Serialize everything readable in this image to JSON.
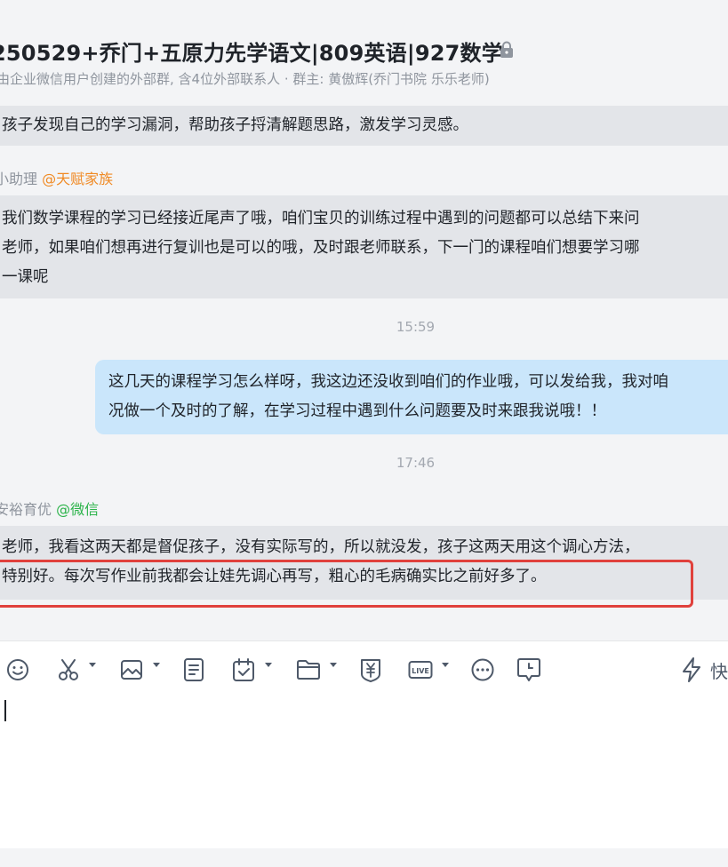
{
  "header": {
    "title": "250529+乔门+五原力先学语文|809英语|927数学",
    "subtitle": "由企业微信用户创建的外部群, 含4位外部联系人 · 群主: 黄傲辉(乔门书院 乐乐老师)"
  },
  "messages": [
    {
      "type": "left",
      "lines": [
        "孩子发现自己的学习漏洞，帮助孩子捋清解题思路，激发学习灵感。"
      ]
    },
    {
      "type": "left",
      "sender": {
        "name": "小助理",
        "org": "@天赋家族"
      },
      "lines": [
        "我们数学课程的学习已经接近尾声了哦，咱们宝贝的训练过程中遇到的问题都可以总结下来问",
        "老师，如果咱们想再进行复训也是可以的哦，及时跟老师联系，下一门的课程咱们想要学习哪",
        "一课呢"
      ]
    },
    {
      "type": "time",
      "text": "15:59"
    },
    {
      "type": "right",
      "lines": [
        "这几天的课程学习怎么样呀，我这边还没收到咱们的作业哦，可以发给我，我对咱",
        "况做一个及时的了解，在学习过程中遇到什么问题要及时来跟我说哦！！"
      ]
    },
    {
      "type": "time",
      "text": "17:46"
    },
    {
      "type": "left",
      "sender": {
        "name": "安裕育优",
        "org": "@微信"
      },
      "lines": [
        "老师，我看这两天都是督促孩子，没有实际写的，所以就没发，孩子这两天用这个调心方法，",
        "特别好。每次写作业前我都会让娃先调心再写，粗心的毛病确实比之前好多了。"
      ]
    }
  ],
  "toolbar": {
    "icons": [
      "emoji-icon",
      "scissors-icon",
      "image-icon",
      "document-icon",
      "task-icon",
      "folder-icon",
      "payment-icon",
      "live-icon",
      "more-icon",
      "schedule-message-icon"
    ],
    "quick_label": "快"
  },
  "colors": {
    "accent_green": "#2bb34a",
    "accent_orange": "#f08a24",
    "self_bubble": "#cae6fb",
    "other_bubble": "#e3e5e9",
    "highlight": "#e0413c"
  }
}
